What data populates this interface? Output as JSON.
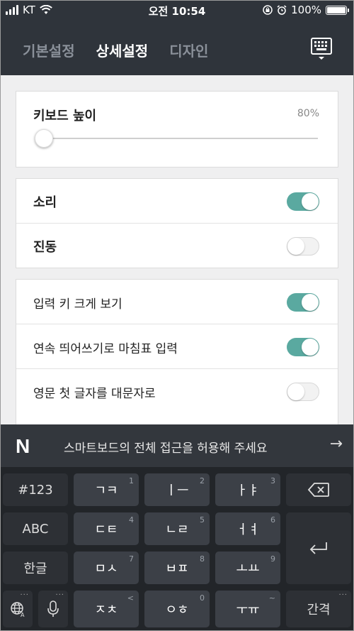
{
  "status": {
    "carrier": "KT",
    "time": "오전 10:54",
    "battery": "100%",
    "battery_level": 1.0
  },
  "tabs": [
    {
      "label": "기본설정",
      "active": false
    },
    {
      "label": "상세설정",
      "active": true
    },
    {
      "label": "디자인",
      "active": false
    }
  ],
  "keyboard_height": {
    "label": "키보드 높이",
    "value": "80%",
    "level": 0.0
  },
  "group1": [
    {
      "label": "소리",
      "on": true
    },
    {
      "label": "진동",
      "on": false
    }
  ],
  "group2": [
    {
      "label": "입력 키 크게 보기",
      "on": true
    },
    {
      "label": "연속 띄어쓰기로 마침표 입력",
      "on": true
    },
    {
      "label": "영문 첫 글자를 대문자로",
      "on": false
    }
  ],
  "banner": {
    "logo": "N",
    "message": "스마트보드의 전체 접근을 허용해 주세요"
  },
  "keys": {
    "num_mode": "#123",
    "abc_mode": "ABC",
    "hangul_mode": "한글",
    "space": "간격",
    "k1": {
      "label": "ㄱㅋ",
      "sub": "1"
    },
    "k2": {
      "label": "ㅣㅡ",
      "sub": "2"
    },
    "k3": {
      "label": "ㅏㅑ",
      "sub": "3"
    },
    "k4": {
      "label": "ㄷㅌ",
      "sub": "4"
    },
    "k5": {
      "label": "ㄴㄹ",
      "sub": "5"
    },
    "k6": {
      "label": "ㅓㅕ",
      "sub": "6"
    },
    "k7": {
      "label": "ㅁㅅ",
      "sub": "7"
    },
    "k8": {
      "label": "ㅂㅍ",
      "sub": "8"
    },
    "k9": {
      "label": "ㅗㅛ",
      "sub": "9"
    },
    "kstar": {
      "label": "ㅈㅊ",
      "sub": "<"
    },
    "k0": {
      "label": "ㅇㅎ",
      "sub": "0"
    },
    "kpound": {
      "label": "ㅜㅠ",
      "sub": "~"
    }
  },
  "colors": {
    "header_bg": "#2f343b",
    "toggle_on": "#5aa9a0",
    "keyboard_bg": "#222529",
    "key_bg": "#3c4047"
  }
}
